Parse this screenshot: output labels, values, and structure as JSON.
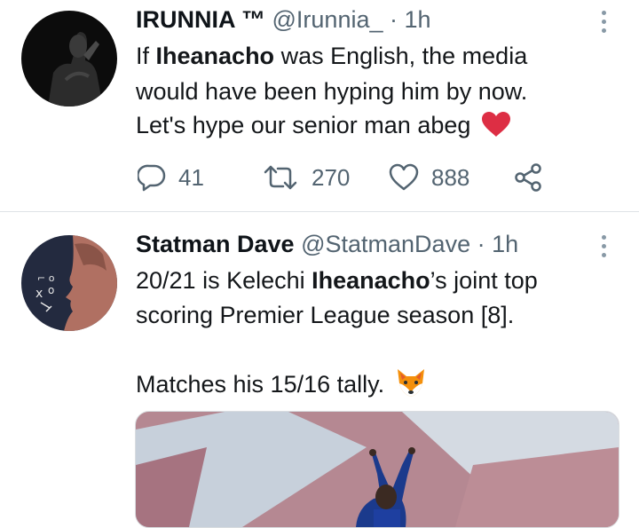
{
  "tweets": [
    {
      "display_name": "IRUNNIA ™",
      "handle": "@Irunnia_",
      "time": "· 1h",
      "lines": [
        {
          "pre": "If ",
          "bold": "Iheanacho",
          "post": " was English, the media"
        },
        {
          "pre": "would have been hyping him by now.",
          "bold": "",
          "post": ""
        },
        {
          "pre": "Let's hype our senior man abeg",
          "bold": "",
          "post": ""
        }
      ],
      "emoji": "red-heart",
      "replies": "41",
      "retweets": "270",
      "likes": "888"
    },
    {
      "display_name": "Statman Dave",
      "handle": "@StatmanDave",
      "time": "· 1h",
      "lines": [
        {
          "pre": "20/21 is Kelechi ",
          "bold": "Iheanacho",
          "post": "’s joint top"
        },
        {
          "pre": "scoring Premier League season [8].",
          "bold": "",
          "post": ""
        },
        {
          "pre": "",
          "bold": "",
          "post": ""
        },
        {
          "pre": "Matches his 15/16 tally.",
          "bold": "",
          "post": ""
        }
      ],
      "emoji": "fox-face",
      "media": "player-celebration-photo"
    }
  ],
  "colors": {
    "meta": "#536471",
    "heart": "#e0245e",
    "divider": "#dfe3e6"
  }
}
